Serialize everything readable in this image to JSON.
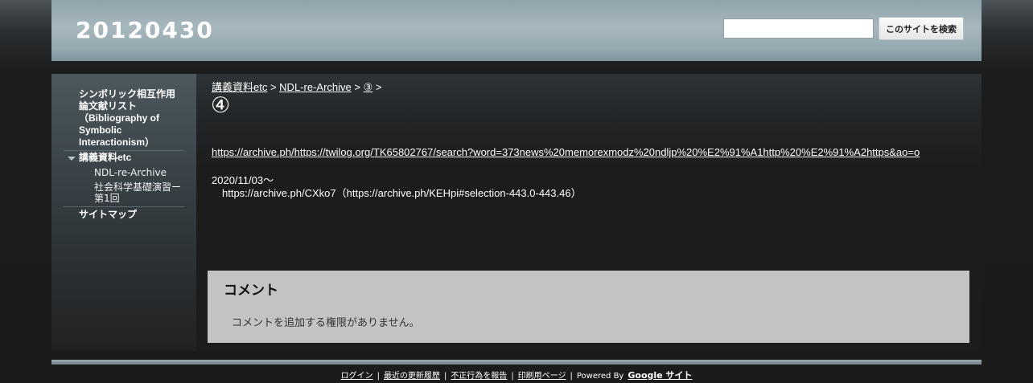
{
  "header": {
    "site_title": "20120430",
    "search_placeholder": "",
    "search_button": "このサイトを検索"
  },
  "sidebar": {
    "item_bibliography_line1": "シンボリック相互作用",
    "item_bibliography_line2": "論文献リスト",
    "item_bibliography_line3": "（Bibliography of",
    "item_bibliography_line4": "Symbolic",
    "item_bibliography_line5": "Interactionism）",
    "item_lecture": "講義資料etc",
    "sub_ndl": "NDL-re-Archive",
    "sub_social_line1": "社会科学基礎演習ー",
    "sub_social_line2": "第1回",
    "item_sitemap": "サイトマップ"
  },
  "breadcrumb": {
    "crumb1": "講義資料etc",
    "sep1": " > ",
    "crumb2": "NDL-re-Archive",
    "sep2": " > ",
    "crumb3": "③",
    "sep3": " >"
  },
  "page": {
    "title": "④",
    "archive_link": "https://archive.ph/https://twilog.org/TK65802767/search?word=373news%20memorexmodz%20ndljp%20%E2%91%A1http%20%E2%91%A2https&ao=o",
    "date_line": "2020/11/03～",
    "archive_line": "https://archive.ph/CXko7（https://archive.ph/KEHpi#selection-443.0-443.46）"
  },
  "comments": {
    "heading": "コメント",
    "note": "コメントを追加する権限がありません。"
  },
  "footer": {
    "login": "ログイン",
    "recent": "最近の更新履歴",
    "report": "不正行為を報告",
    "print": "印刷用ページ",
    "powered": "Powered By",
    "google_sites": "Google サイト",
    "separator": "|"
  },
  "colors": {
    "header_bg": "#a7b8bd",
    "sidebar_bg": "#4d585e",
    "comments_bg": "#c3c3c3",
    "page_bg": "#1c1c1c"
  }
}
